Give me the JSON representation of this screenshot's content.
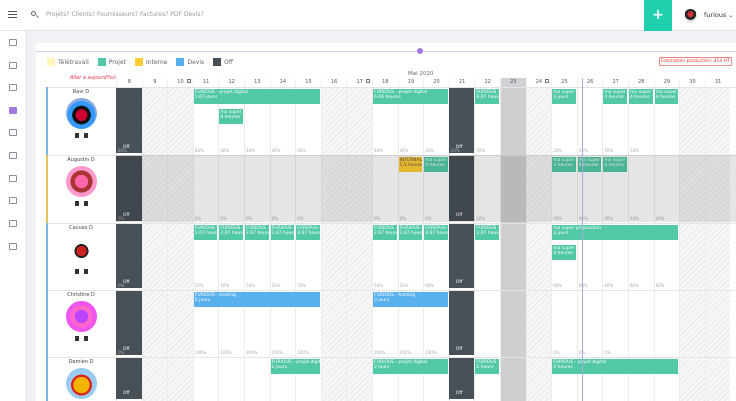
{
  "topbar": {
    "search_placeholder": "Projets? Clients? Fournisseurs? Factures? PDF Devis?",
    "add_label": "+",
    "user_name": "furious"
  },
  "legend": [
    {
      "label": "Télétravail",
      "color": "#fff5b8"
    },
    {
      "label": "Projet",
      "color": "#52c8a6"
    },
    {
      "label": "Interne",
      "color": "#ffcc33"
    },
    {
      "label": "Devis",
      "color": "#58b1ec"
    },
    {
      "label": "Off",
      "color": "#474f57"
    }
  ],
  "estimation": "Estimation production: 414 HT",
  "today_link": "Aller à aujourd'hui",
  "month": "Mai 2020",
  "days": [
    "8",
    "9",
    "10",
    "11",
    "12",
    "13",
    "14",
    "15",
    "16",
    "17",
    "18",
    "19",
    "20",
    "21",
    "22",
    "23",
    "24",
    "25",
    "26",
    "27",
    "28",
    "29",
    "30",
    "31"
  ],
  "people": [
    {
      "name": "Ravi D"
    },
    {
      "name": "Augustin D"
    },
    {
      "name": "Cavuso D"
    },
    {
      "name": "Christine D"
    },
    {
      "name": "Damien D"
    }
  ],
  "off_label": "Off",
  "events": {
    "r0": [
      {
        "t": "FURIOUS - projet digital",
        "s": "1.67 jours"
      },
      {
        "t": "FURIOUS - projet digital",
        "s": "6.66 heures"
      },
      {
        "t": "FURIOUS -",
        "s": "6.67 heure"
      },
      {
        "t": "ma super",
        "s": "4 heures"
      },
      {
        "t": "ma super",
        "s": "3 jours"
      },
      {
        "t": "ma super",
        "s": "4 heures"
      },
      {
        "t": "ma super",
        "s": "4 heures"
      },
      {
        "t": "ma super",
        "s": "4 heures"
      }
    ],
    "r1": [
      {
        "t": "INTERNAL",
        "s": "1.5 heures"
      },
      {
        "t": "ma super",
        "s": "4 heures"
      },
      {
        "t": "ma super",
        "s": "3 heures"
      },
      {
        "t": "ma super",
        "s": "4 heures"
      },
      {
        "t": "ma super",
        "s": "4 heures"
      }
    ],
    "r2": [
      {
        "t": "FURIOUS -",
        "s": "2.67 heure"
      },
      {
        "t": "ma super proposition",
        "s": "2 jours"
      },
      {
        "t": "ma super",
        "s": "4 heures"
      }
    ],
    "r3": [
      {
        "t": "FURIOUS - hosting",
        "s": "5 jours"
      },
      {
        "t": "FURIOUS - hosting",
        "s": "3 jours"
      }
    ],
    "r4": [
      {
        "t": "FURIOUS - projet digital",
        "s": "2 jours"
      },
      {
        "t": "FURIOUS - projet digital",
        "s": "2 jours"
      },
      {
        "t": "FURIOUS -",
        "s": "2 heure"
      },
      {
        "t": "FURIOUS - projet digital",
        "s": "2 heures"
      }
    ]
  },
  "pcts": {
    "r0": [
      "80%",
      "60%",
      "40%",
      "40%",
      "40%",
      "60%",
      "40%",
      "40%",
      "40%",
      "20%",
      "50%",
      "20%",
      "50%",
      "50%",
      "50%"
    ],
    "r1": [
      "0%",
      "0%",
      "0%",
      "0%",
      "0%",
      "0%",
      "0%",
      "0%",
      "0%",
      "20%",
      "40%",
      "40%",
      "40%",
      "40%",
      "40%"
    ],
    "r2": [
      "0%",
      "20%",
      "50%",
      "50%",
      "50%",
      "50%",
      "50%",
      "50%",
      "60%",
      "60%",
      "60%",
      "60%",
      "60%",
      "60%"
    ],
    "r3": [
      "0%",
      "100%",
      "100%",
      "100%",
      "100%",
      "100%",
      "100%",
      "100%",
      "100%",
      "0%",
      "0%",
      "0%"
    ],
    "r4": []
  }
}
